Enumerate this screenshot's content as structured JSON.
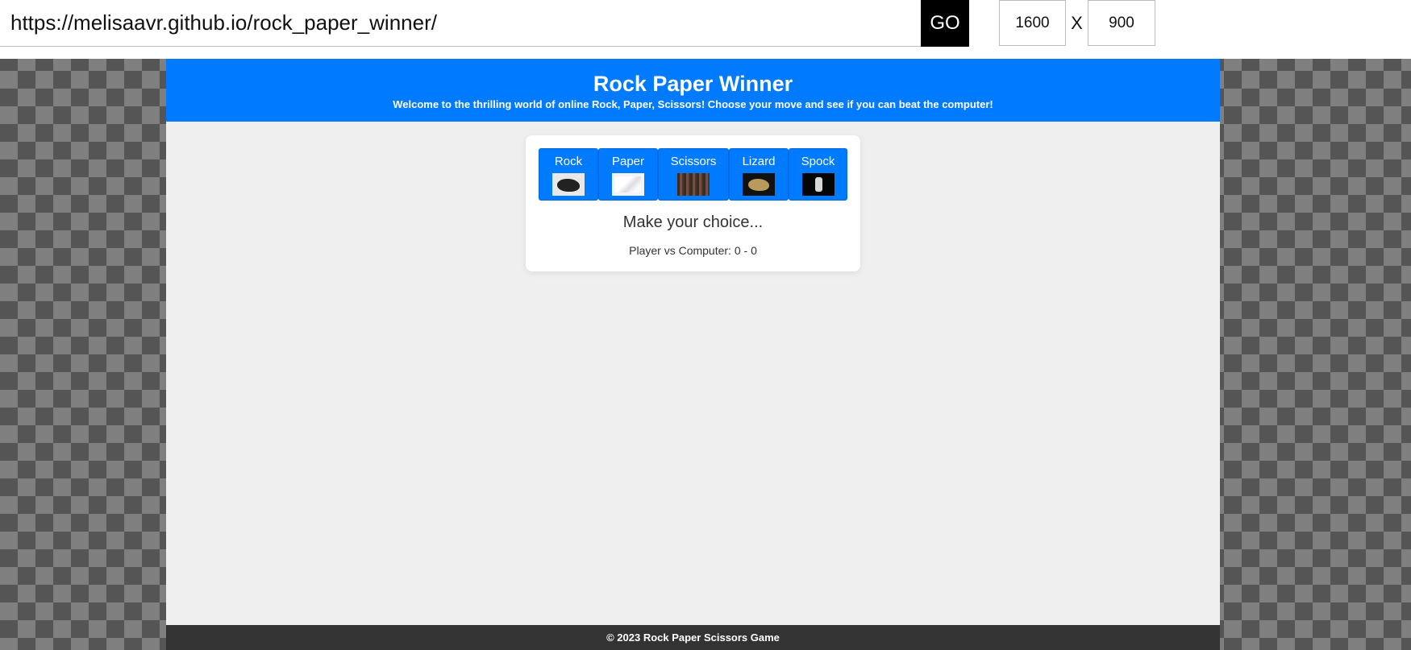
{
  "browser": {
    "url": "https://melisaavr.github.io/rock_paper_winner/",
    "go_label": "GO",
    "width": "1600",
    "separator": "X",
    "height": "900"
  },
  "header": {
    "title": "Rock Paper Winner",
    "subtitle": "Welcome to the thrilling world of online Rock, Paper, Scissors! Choose your move and see if you can beat the computer!"
  },
  "choices": [
    {
      "label": "Rock",
      "icon": "rock-image"
    },
    {
      "label": "Paper",
      "icon": "paper-image"
    },
    {
      "label": "Scissors",
      "icon": "scissors-image"
    },
    {
      "label": "Lizard",
      "icon": "lizard-image"
    },
    {
      "label": "Spock",
      "icon": "spock-hand-image"
    }
  ],
  "game": {
    "result": "Make your choice...",
    "score": "Player vs Computer: 0 - 0"
  },
  "footer": {
    "text": "© 2023 Rock Paper Scissors Game"
  },
  "colors": {
    "accent": "#007bff",
    "footer": "#333333",
    "page_background": "#efefef"
  }
}
